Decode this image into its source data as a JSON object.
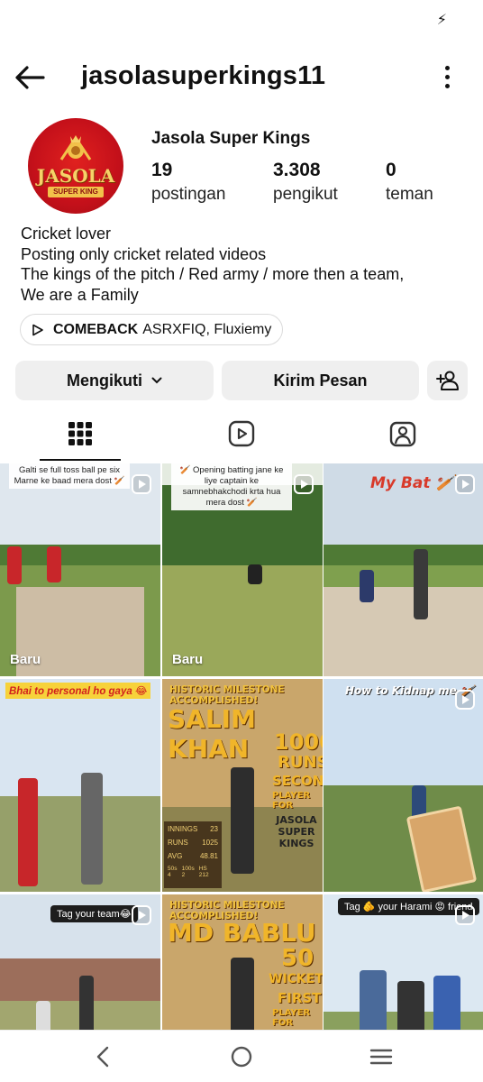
{
  "status_bar": {
    "charging_icon": "bolt-icon"
  },
  "header": {
    "back_icon": "arrow-left-icon",
    "username": "jasolasuperkings11",
    "menu_icon": "more-vertical-icon"
  },
  "profile": {
    "avatar_logo_text": "JASOLA",
    "avatar_logo_sub": "SUPER KING",
    "full_name": "Jasola Super Kings",
    "stats": [
      {
        "value": "19",
        "label": "postingan"
      },
      {
        "value": "3.308",
        "label": "pengikut"
      },
      {
        "value": "0",
        "label": "teman"
      }
    ],
    "bio_lines": [
      "Cricket lover",
      "Posting only cricket related videos",
      "The kings of the pitch / Red army / more then a team,",
      "We are a Family"
    ],
    "music": {
      "title": "COMEBACK",
      "artists": "ASRXFIQ, Fluxiemy"
    }
  },
  "actions": {
    "follow_label": "Mengikuti",
    "message_label": "Kirim Pesan",
    "add_user_icon": "add-person-icon"
  },
  "tabs": [
    "grid-icon",
    "reels-icon",
    "tagged-icon"
  ],
  "posts": [
    {
      "caption": "Galti se full toss ball pe six Marne ke baad mera dost 🏏",
      "label": "Baru"
    },
    {
      "caption": "🏏 Opening batting jane ke liye captain ke samnebhakchodi krta hua mera dost 🏏",
      "label": "Baru"
    },
    {
      "overlay": "My Bat 🏏"
    },
    {
      "overlay": "Bhai to personal ho gaya 😂"
    },
    {
      "headline": "HISTORIC MILESTONE ACCOMPLISHED!",
      "name": "SALIM KHAN",
      "big": "1000",
      "big2": "RUNS",
      "big3": "SECOND",
      "sub": "PLAYER FOR",
      "team": "JASOLA SUPER KINGS",
      "stats": [
        [
          "INNINGS",
          "23"
        ],
        [
          "RUNS",
          "1025"
        ],
        [
          "AVG",
          "48.81"
        ],
        [
          "50s 4",
          "100s 2",
          "HS 212"
        ]
      ]
    },
    {
      "overlay": "How to Kidnap me 🏏"
    },
    {
      "overlay": "Tag your team😂"
    },
    {
      "headline": "HISTORIC MILESTONE ACCOMPLISHED!",
      "name": "MD BABLU",
      "big": "50",
      "big2": "WICKETS",
      "big3": "FIRST",
      "sub": "PLAYER FOR"
    },
    {
      "overlay": "Tag 🫵 your Harami 😡 friend"
    }
  ],
  "nav": [
    "back-nav-icon",
    "home-nav-icon",
    "recents-nav-icon"
  ],
  "colors": {
    "accent_red": "#d2211d",
    "button_bg": "#efefef",
    "text": "#111111"
  }
}
